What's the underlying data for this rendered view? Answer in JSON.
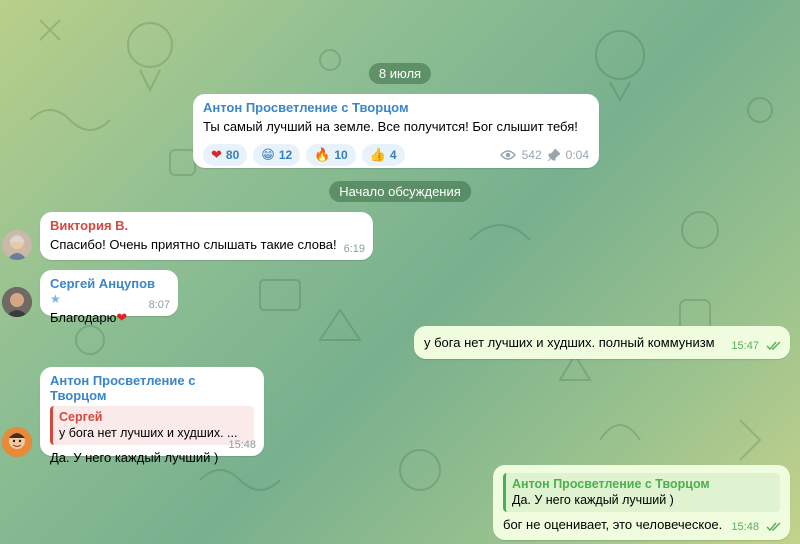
{
  "colors": {
    "channel_name": "#3a86c8",
    "viktoria": "#d4493f",
    "sergey_a": "#3a86c8",
    "reply_red": "#d4493f",
    "reply_green": "#4caf50",
    "outgoing_time": "#5cae5c"
  },
  "date_pill": "8 июля",
  "channel_post": {
    "sender": "Антон Просветление с Творцом",
    "text": "Ты самый лучший на земле. Все получится! Бог слышит тебя!",
    "reactions": [
      {
        "icon": "heart-emoji",
        "emoji": "❤",
        "count": "80"
      },
      {
        "icon": "grin-emoji",
        "emoji": "😁",
        "count": "12"
      },
      {
        "icon": "fire-emoji",
        "emoji": "🔥",
        "count": "10"
      },
      {
        "icon": "thumbs-up-emoji",
        "emoji": "👍",
        "count": "4"
      }
    ],
    "views": "542",
    "time": "0:04"
  },
  "discussion_pill": "Начало обсуждения",
  "messages": [
    {
      "sender": "Виктория В.",
      "text": "Спасибо! Очень приятно слышать такие слова!",
      "time": "6:19"
    },
    {
      "sender": "Сергей Анцупов",
      "text": "Благодарю",
      "emoji": "❤",
      "time": "8:07"
    },
    {
      "text": "у бога нет лучших и худших. полный коммунизм",
      "time": "15:47"
    },
    {
      "sender": "Антон Просветление с Творцом",
      "reply_name": "Сергей",
      "reply_text": "у бога нет лучших и худших. ...",
      "text": "Да. У него каждый лучший )",
      "time": "15:48"
    },
    {
      "reply_name": "Антон Просветление с Творцом",
      "reply_text": "Да. У него каждый лучший )",
      "text": "бог не оценивает, это человеческое.",
      "time": "15:48"
    }
  ]
}
